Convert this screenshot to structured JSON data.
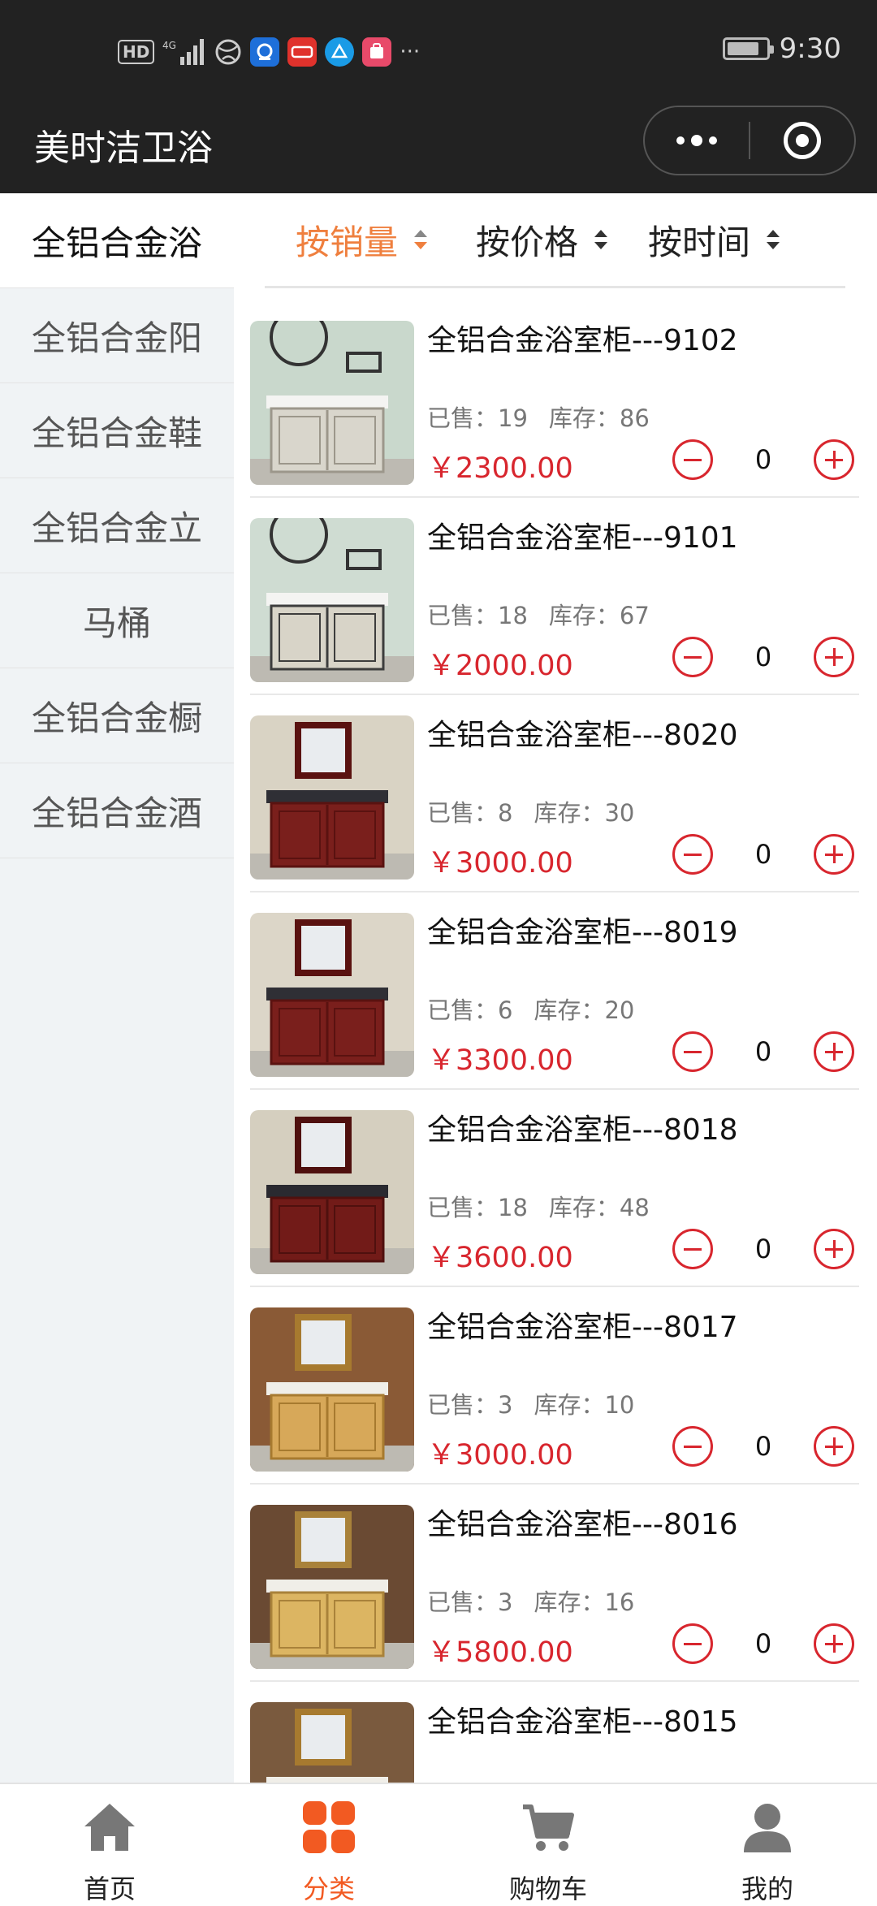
{
  "status_bar": {
    "indicators": [
      "HD",
      "4G",
      "signal-icon",
      "globe-icon",
      "app-icon-1",
      "app-icon-2",
      "app-icon-3",
      "app-icon-4",
      "..."
    ],
    "time": "9:30",
    "battery_level": 0.75
  },
  "nav": {
    "title": "美时洁卫浴"
  },
  "sidebar": {
    "items": [
      {
        "label": "全铝合金浴",
        "active": true
      },
      {
        "label": "全铝合金阳",
        "active": false
      },
      {
        "label": "全铝合金鞋",
        "active": false
      },
      {
        "label": "全铝合金立",
        "active": false
      },
      {
        "label": "马桶",
        "active": false
      },
      {
        "label": "全铝合金橱",
        "active": false
      },
      {
        "label": "全铝合金酒",
        "active": false
      }
    ]
  },
  "sort": {
    "options": [
      {
        "label": "按销量",
        "active": true
      },
      {
        "label": "按价格",
        "active": false
      },
      {
        "label": "按时间",
        "active": false
      }
    ]
  },
  "products": [
    {
      "name": "全铝合金浴室柜---9102",
      "sold_label": "已售：19",
      "stock_label": "库存：86",
      "price": "￥2300.00",
      "qty": "0"
    },
    {
      "name": "全铝合金浴室柜---9101",
      "sold_label": "已售：18",
      "stock_label": "库存：67",
      "price": "￥2000.00",
      "qty": "0"
    },
    {
      "name": "全铝合金浴室柜---8020",
      "sold_label": "已售：8",
      "stock_label": "库存：30",
      "price": "￥3000.00",
      "qty": "0"
    },
    {
      "name": "全铝合金浴室柜---8019",
      "sold_label": "已售：6",
      "stock_label": "库存：20",
      "price": "￥3300.00",
      "qty": "0"
    },
    {
      "name": "全铝合金浴室柜---8018",
      "sold_label": "已售：18",
      "stock_label": "库存：48",
      "price": "￥3600.00",
      "qty": "0"
    },
    {
      "name": "全铝合金浴室柜---8017",
      "sold_label": "已售：3",
      "stock_label": "库存：10",
      "price": "￥3000.00",
      "qty": "0"
    },
    {
      "name": "全铝合金浴室柜---8016",
      "sold_label": "已售：3",
      "stock_label": "库存：16",
      "price": "￥5800.00",
      "qty": "0"
    },
    {
      "name": "全铝合金浴室柜---8015",
      "sold_label": "",
      "stock_label": "",
      "price": "",
      "qty": ""
    }
  ],
  "tabbar": {
    "tabs": [
      {
        "label": "首页",
        "icon": "home-icon",
        "active": false
      },
      {
        "label": "分类",
        "icon": "category-icon",
        "active": true
      },
      {
        "label": "购物车",
        "icon": "cart-icon",
        "active": false
      },
      {
        "label": "我的",
        "icon": "user-icon",
        "active": false
      }
    ]
  },
  "colors": {
    "accent": "#d8262e",
    "sort_active": "#ef7f3e",
    "tab_active": "#f25a22"
  }
}
